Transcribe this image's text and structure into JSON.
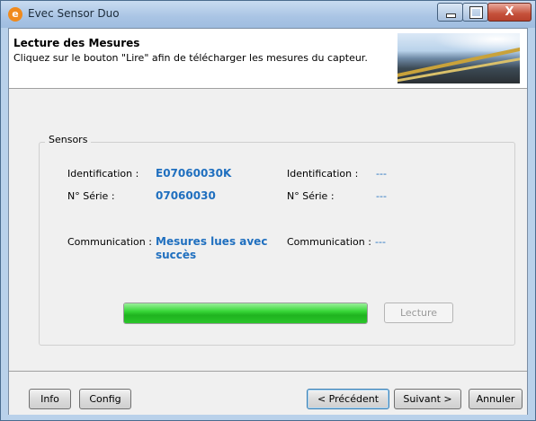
{
  "window": {
    "title": "Evec Sensor Duo",
    "app_icon": "e",
    "close_glyph": "X"
  },
  "header": {
    "title": "Lecture des Mesures",
    "subtitle": "Cliquez sur le bouton \"Lire\" afin de télécharger les mesures du capteur."
  },
  "sensors": {
    "group_label": "Sensors",
    "left": {
      "identification_label": "Identification :",
      "identification_value": "E07060030K",
      "serial_label": "N° Série :",
      "serial_value": "07060030",
      "communication_label": "Communication :",
      "communication_value_line1": "Mesures lues avec",
      "communication_value_line2": "succès"
    },
    "right": {
      "identification_label": "Identification :",
      "identification_value": "---",
      "serial_label": "N° Série :",
      "serial_value": "---",
      "communication_label": "Communication :",
      "communication_value": "---"
    }
  },
  "progress": {
    "percent": 100,
    "color": "#2ac62a"
  },
  "buttons": {
    "lecture": "Lecture",
    "info": "Info",
    "config": "Config",
    "previous": "< Précédent",
    "next": "Suivant >",
    "cancel": "Annuler"
  }
}
